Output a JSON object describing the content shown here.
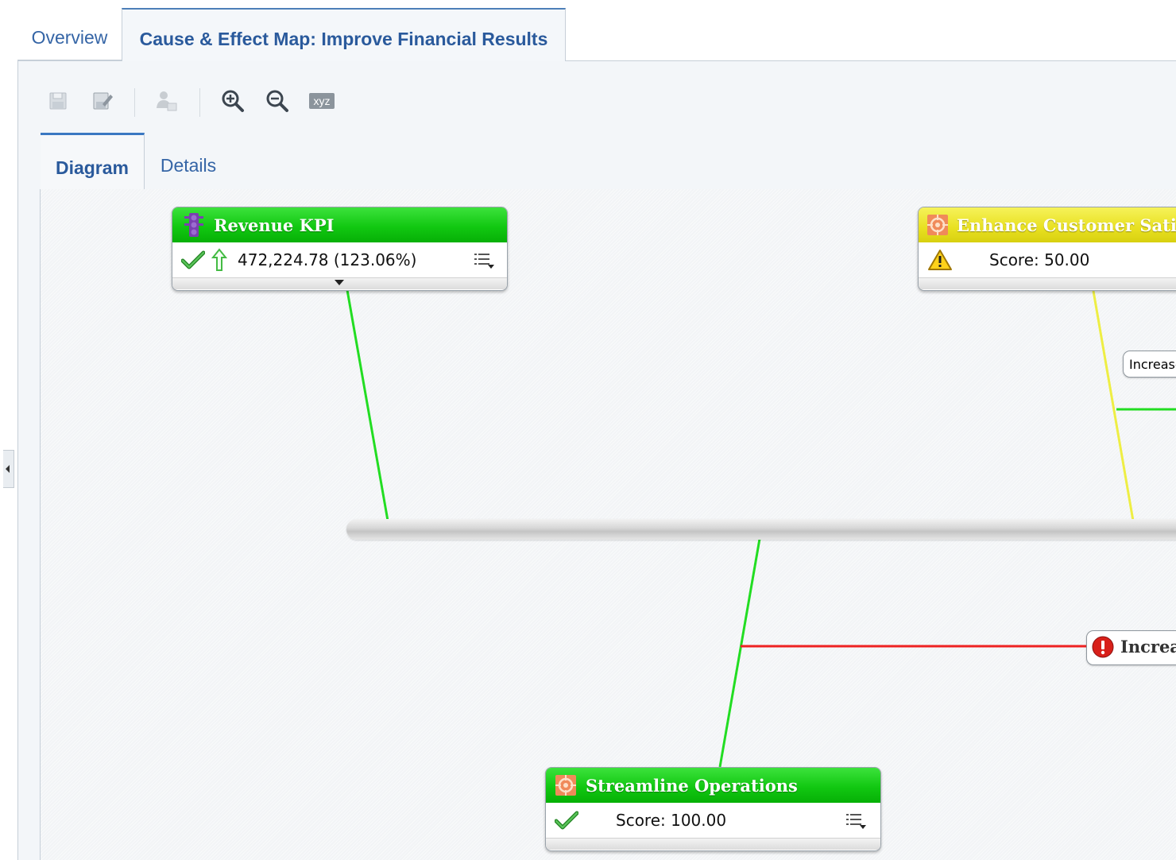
{
  "tabs": {
    "overview": "Overview",
    "active": "Cause & Effect Map: Improve Financial Results"
  },
  "toolbar": {
    "icons": [
      "save-icon",
      "save-as-icon",
      "assign-user-icon",
      "zoom-in-icon",
      "zoom-out-icon",
      "xyz-icon"
    ],
    "xyz_label": "xyz"
  },
  "subtabs": {
    "diagram": "Diagram",
    "details": "Details"
  },
  "nodes": {
    "revenue": {
      "title": "Revenue KPI",
      "value": "472,224.78 (123.06%)",
      "status": "ok",
      "trend": "up",
      "header_color": "#18c818"
    },
    "customer": {
      "title": "Enhance Customer Satisfaction",
      "score": "Score: 50.00",
      "status": "warning",
      "header_color": "#e8e020"
    },
    "streamline": {
      "title": "Streamline Operations",
      "score": "Score: 100.00",
      "status": "ok",
      "header_color": "#18c818"
    }
  },
  "small_node": {
    "label": "Increase"
  },
  "critical_node": {
    "label": "Increase",
    "status": "critical"
  },
  "colors": {
    "link_green": "#22dd22",
    "link_yellow": "#eeee44",
    "link_red": "#ee2222"
  }
}
